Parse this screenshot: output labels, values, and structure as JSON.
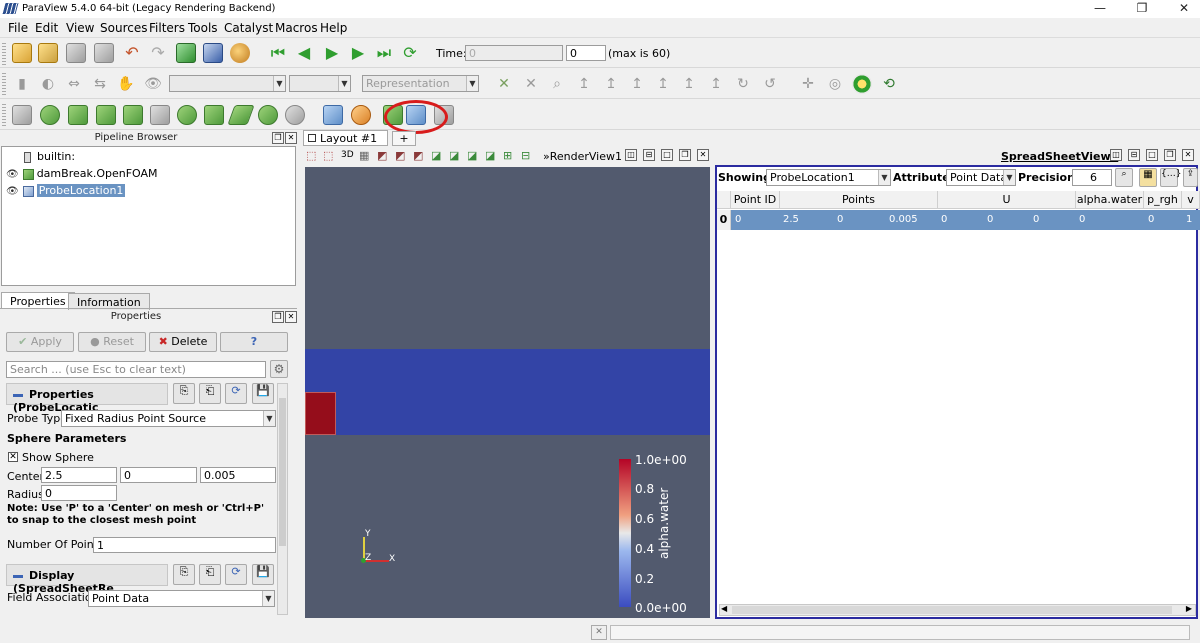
{
  "window": {
    "title": "ParaView 5.4.0 64-bit (Legacy Rendering Backend)",
    "minimize": "—",
    "restore": "❐",
    "close": "✕"
  },
  "menu": [
    "File",
    "Edit",
    "View",
    "Sources",
    "Filters",
    "Tools",
    "Catalyst",
    "Macros",
    "Help"
  ],
  "time_toolbar": {
    "time_label": "Time:",
    "time_value": "0",
    "step_value": "0",
    "max_text": "(max is 60)"
  },
  "view_toolbar": {
    "representation": "Representation"
  },
  "pipeline": {
    "header": "Pipeline Browser",
    "items": [
      {
        "label": "builtin:"
      },
      {
        "label": "damBreak.OpenFOAM"
      },
      {
        "label": "ProbeLocation1"
      }
    ]
  },
  "panel_tabs": [
    "Properties",
    "Information"
  ],
  "properties": {
    "header": "Properties",
    "apply": "Apply",
    "reset": "Reset",
    "delete": "Delete",
    "help": "?",
    "search_placeholder": "Search ... (use Esc to clear text)",
    "section_title": "Properties (ProbeLocatic",
    "probe_type_label": "Probe Type",
    "probe_type_value": "Fixed Radius Point Source",
    "sphere_params": "Sphere Parameters",
    "show_sphere": "Show Sphere",
    "center_label": "Center",
    "center_values": [
      "2.5",
      "0",
      "0.005"
    ],
    "radius_label": "Radius",
    "radius_value": "0",
    "note": "Note: Use 'P' to a 'Center' on mesh or 'Ctrl+P' to snap to the closest mesh point",
    "num_points_label": "Number Of Points",
    "num_points_value": "1",
    "display_section": "Display (SpreadSheetRe",
    "field_assoc_label": "Field Association",
    "field_assoc_value": "Point Data"
  },
  "layout": {
    "tab": "Layout #1",
    "close": "✕",
    "add": "+"
  },
  "renderview": {
    "label": "RenderView1",
    "mode": "3D",
    "colorbar": {
      "title": "alpha.water",
      "ticks": [
        "1.0e+00",
        "0.8",
        "0.6",
        "0.4",
        "0.2",
        "0.0e+00"
      ]
    },
    "axes": {
      "y": "Y",
      "z": "Z",
      "x": "X"
    }
  },
  "spreadsheet": {
    "label": "SpreadSheetView1",
    "showing_label": "Showing",
    "showing_value": "ProbeLocation1",
    "attribute_label": "Attribute:",
    "attribute_value": "Point Data",
    "precision_label": "Precision:",
    "precision_value": "6",
    "columns": [
      "Point ID",
      "Points",
      "U",
      "alpha.water",
      "p_rgh",
      "v"
    ],
    "row_index": "0",
    "row": [
      "0",
      "2.5",
      "0",
      "0.005",
      "0",
      "0",
      "0",
      "0",
      "0",
      "1"
    ]
  },
  "colors": {
    "accent": "#2b2ba0",
    "selection": "#6a93c2",
    "render_bg": "#525a6e",
    "water": "#3344a6",
    "block": "#950d1b",
    "highlight_circle": "#d81c1c"
  }
}
